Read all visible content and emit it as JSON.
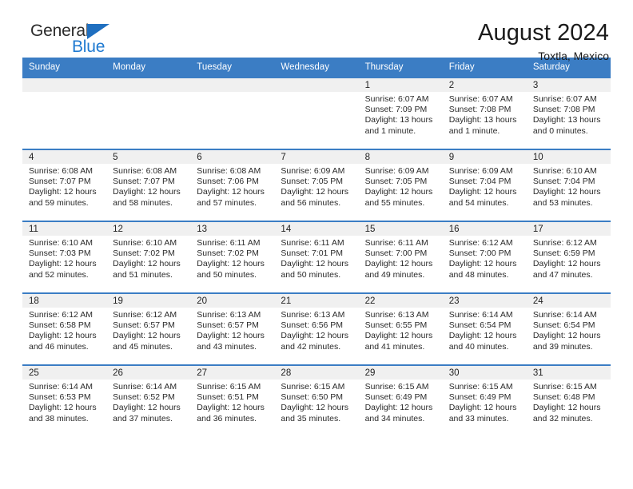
{
  "logo": {
    "word_top": "General",
    "word_bottom": "Blue",
    "triangle_color": "#1f6fc0",
    "blue_color": "#1f7ad1"
  },
  "header": {
    "title": "August 2024",
    "subtitle": "Toxtla, Mexico"
  },
  "colors": {
    "header_blue": "#3b7dc4",
    "daynum_band": "#f0f0f0",
    "text": "#2a2a2a"
  },
  "weekday_headers": [
    "Sunday",
    "Monday",
    "Tuesday",
    "Wednesday",
    "Thursday",
    "Friday",
    "Saturday"
  ],
  "labels": {
    "sunrise_prefix": "Sunrise:",
    "sunset_prefix": "Sunset:",
    "daylight_prefix": "Daylight:"
  },
  "weeks": [
    [
      {
        "day": "",
        "sunrise": "",
        "sunset": "",
        "daylight_line1": "",
        "daylight_line2": ""
      },
      {
        "day": "",
        "sunrise": "",
        "sunset": "",
        "daylight_line1": "",
        "daylight_line2": ""
      },
      {
        "day": "",
        "sunrise": "",
        "sunset": "",
        "daylight_line1": "",
        "daylight_line2": ""
      },
      {
        "day": "",
        "sunrise": "",
        "sunset": "",
        "daylight_line1": "",
        "daylight_line2": ""
      },
      {
        "day": "1",
        "sunrise": "Sunrise: 6:07 AM",
        "sunset": "Sunset: 7:09 PM",
        "daylight_line1": "Daylight: 13 hours",
        "daylight_line2": "and 1 minute."
      },
      {
        "day": "2",
        "sunrise": "Sunrise: 6:07 AM",
        "sunset": "Sunset: 7:08 PM",
        "daylight_line1": "Daylight: 13 hours",
        "daylight_line2": "and 1 minute."
      },
      {
        "day": "3",
        "sunrise": "Sunrise: 6:07 AM",
        "sunset": "Sunset: 7:08 PM",
        "daylight_line1": "Daylight: 13 hours",
        "daylight_line2": "and 0 minutes."
      }
    ],
    [
      {
        "day": "4",
        "sunrise": "Sunrise: 6:08 AM",
        "sunset": "Sunset: 7:07 PM",
        "daylight_line1": "Daylight: 12 hours",
        "daylight_line2": "and 59 minutes."
      },
      {
        "day": "5",
        "sunrise": "Sunrise: 6:08 AM",
        "sunset": "Sunset: 7:07 PM",
        "daylight_line1": "Daylight: 12 hours",
        "daylight_line2": "and 58 minutes."
      },
      {
        "day": "6",
        "sunrise": "Sunrise: 6:08 AM",
        "sunset": "Sunset: 7:06 PM",
        "daylight_line1": "Daylight: 12 hours",
        "daylight_line2": "and 57 minutes."
      },
      {
        "day": "7",
        "sunrise": "Sunrise: 6:09 AM",
        "sunset": "Sunset: 7:05 PM",
        "daylight_line1": "Daylight: 12 hours",
        "daylight_line2": "and 56 minutes."
      },
      {
        "day": "8",
        "sunrise": "Sunrise: 6:09 AM",
        "sunset": "Sunset: 7:05 PM",
        "daylight_line1": "Daylight: 12 hours",
        "daylight_line2": "and 55 minutes."
      },
      {
        "day": "9",
        "sunrise": "Sunrise: 6:09 AM",
        "sunset": "Sunset: 7:04 PM",
        "daylight_line1": "Daylight: 12 hours",
        "daylight_line2": "and 54 minutes."
      },
      {
        "day": "10",
        "sunrise": "Sunrise: 6:10 AM",
        "sunset": "Sunset: 7:04 PM",
        "daylight_line1": "Daylight: 12 hours",
        "daylight_line2": "and 53 minutes."
      }
    ],
    [
      {
        "day": "11",
        "sunrise": "Sunrise: 6:10 AM",
        "sunset": "Sunset: 7:03 PM",
        "daylight_line1": "Daylight: 12 hours",
        "daylight_line2": "and 52 minutes."
      },
      {
        "day": "12",
        "sunrise": "Sunrise: 6:10 AM",
        "sunset": "Sunset: 7:02 PM",
        "daylight_line1": "Daylight: 12 hours",
        "daylight_line2": "and 51 minutes."
      },
      {
        "day": "13",
        "sunrise": "Sunrise: 6:11 AM",
        "sunset": "Sunset: 7:02 PM",
        "daylight_line1": "Daylight: 12 hours",
        "daylight_line2": "and 50 minutes."
      },
      {
        "day": "14",
        "sunrise": "Sunrise: 6:11 AM",
        "sunset": "Sunset: 7:01 PM",
        "daylight_line1": "Daylight: 12 hours",
        "daylight_line2": "and 50 minutes."
      },
      {
        "day": "15",
        "sunrise": "Sunrise: 6:11 AM",
        "sunset": "Sunset: 7:00 PM",
        "daylight_line1": "Daylight: 12 hours",
        "daylight_line2": "and 49 minutes."
      },
      {
        "day": "16",
        "sunrise": "Sunrise: 6:12 AM",
        "sunset": "Sunset: 7:00 PM",
        "daylight_line1": "Daylight: 12 hours",
        "daylight_line2": "and 48 minutes."
      },
      {
        "day": "17",
        "sunrise": "Sunrise: 6:12 AM",
        "sunset": "Sunset: 6:59 PM",
        "daylight_line1": "Daylight: 12 hours",
        "daylight_line2": "and 47 minutes."
      }
    ],
    [
      {
        "day": "18",
        "sunrise": "Sunrise: 6:12 AM",
        "sunset": "Sunset: 6:58 PM",
        "daylight_line1": "Daylight: 12 hours",
        "daylight_line2": "and 46 minutes."
      },
      {
        "day": "19",
        "sunrise": "Sunrise: 6:12 AM",
        "sunset": "Sunset: 6:57 PM",
        "daylight_line1": "Daylight: 12 hours",
        "daylight_line2": "and 45 minutes."
      },
      {
        "day": "20",
        "sunrise": "Sunrise: 6:13 AM",
        "sunset": "Sunset: 6:57 PM",
        "daylight_line1": "Daylight: 12 hours",
        "daylight_line2": "and 43 minutes."
      },
      {
        "day": "21",
        "sunrise": "Sunrise: 6:13 AM",
        "sunset": "Sunset: 6:56 PM",
        "daylight_line1": "Daylight: 12 hours",
        "daylight_line2": "and 42 minutes."
      },
      {
        "day": "22",
        "sunrise": "Sunrise: 6:13 AM",
        "sunset": "Sunset: 6:55 PM",
        "daylight_line1": "Daylight: 12 hours",
        "daylight_line2": "and 41 minutes."
      },
      {
        "day": "23",
        "sunrise": "Sunrise: 6:14 AM",
        "sunset": "Sunset: 6:54 PM",
        "daylight_line1": "Daylight: 12 hours",
        "daylight_line2": "and 40 minutes."
      },
      {
        "day": "24",
        "sunrise": "Sunrise: 6:14 AM",
        "sunset": "Sunset: 6:54 PM",
        "daylight_line1": "Daylight: 12 hours",
        "daylight_line2": "and 39 minutes."
      }
    ],
    [
      {
        "day": "25",
        "sunrise": "Sunrise: 6:14 AM",
        "sunset": "Sunset: 6:53 PM",
        "daylight_line1": "Daylight: 12 hours",
        "daylight_line2": "and 38 minutes."
      },
      {
        "day": "26",
        "sunrise": "Sunrise: 6:14 AM",
        "sunset": "Sunset: 6:52 PM",
        "daylight_line1": "Daylight: 12 hours",
        "daylight_line2": "and 37 minutes."
      },
      {
        "day": "27",
        "sunrise": "Sunrise: 6:15 AM",
        "sunset": "Sunset: 6:51 PM",
        "daylight_line1": "Daylight: 12 hours",
        "daylight_line2": "and 36 minutes."
      },
      {
        "day": "28",
        "sunrise": "Sunrise: 6:15 AM",
        "sunset": "Sunset: 6:50 PM",
        "daylight_line1": "Daylight: 12 hours",
        "daylight_line2": "and 35 minutes."
      },
      {
        "day": "29",
        "sunrise": "Sunrise: 6:15 AM",
        "sunset": "Sunset: 6:49 PM",
        "daylight_line1": "Daylight: 12 hours",
        "daylight_line2": "and 34 minutes."
      },
      {
        "day": "30",
        "sunrise": "Sunrise: 6:15 AM",
        "sunset": "Sunset: 6:49 PM",
        "daylight_line1": "Daylight: 12 hours",
        "daylight_line2": "and 33 minutes."
      },
      {
        "day": "31",
        "sunrise": "Sunrise: 6:15 AM",
        "sunset": "Sunset: 6:48 PM",
        "daylight_line1": "Daylight: 12 hours",
        "daylight_line2": "and 32 minutes."
      }
    ]
  ]
}
